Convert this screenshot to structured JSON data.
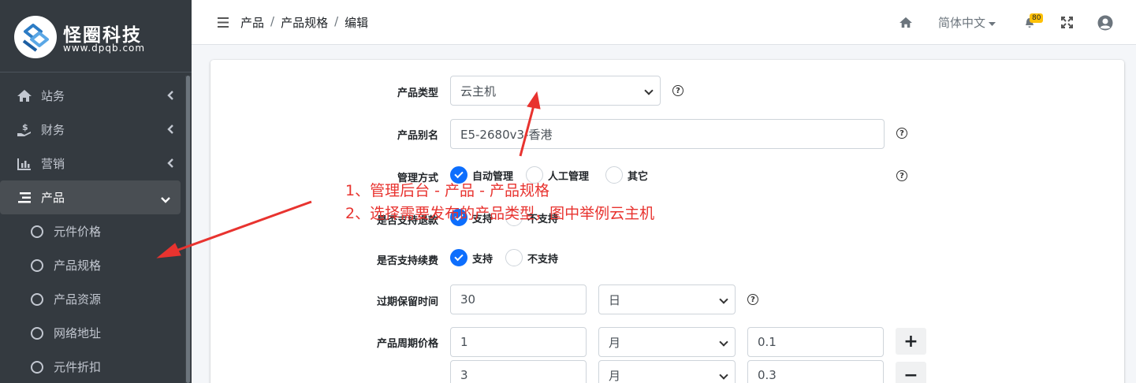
{
  "brand": {
    "name": "怪圈科技",
    "url": "www.dpqb.com"
  },
  "sidebar": {
    "items": [
      {
        "label": "站务",
        "icon": "home-icon"
      },
      {
        "label": "财务",
        "icon": "hand-dollar-icon"
      },
      {
        "label": "营销",
        "icon": "bar-chart-icon"
      },
      {
        "label": "产品",
        "icon": "list-icon"
      }
    ],
    "sub_items": [
      {
        "label": "元件价格"
      },
      {
        "label": "产品规格"
      },
      {
        "label": "产品资源"
      },
      {
        "label": "网络地址"
      },
      {
        "label": "元件折扣"
      }
    ]
  },
  "header": {
    "breadcrumb": [
      "产品",
      "产品规格",
      "编辑"
    ],
    "language": "简体中文",
    "notification_count": "80"
  },
  "form": {
    "product_type": {
      "label": "产品类型",
      "value": "云主机",
      "help": "?"
    },
    "product_alias": {
      "label": "产品别名",
      "value": "E5-2680v3-香港",
      "help": "?"
    },
    "management": {
      "label": "管理方式",
      "options": [
        "自动管理",
        "人工管理",
        "其它"
      ],
      "selected": "自动管理",
      "help": "?"
    },
    "refund": {
      "label": "是否支持退款",
      "options": [
        "支持",
        "不支持"
      ],
      "selected": "支持"
    },
    "renew": {
      "label": "是否支持续费",
      "options": [
        "支持",
        "不支持"
      ],
      "selected": "支持"
    },
    "retention": {
      "label": "过期保留时间",
      "value": "30",
      "unit": "日",
      "help": "?"
    },
    "period_price": {
      "label": "产品周期价格",
      "rows": [
        {
          "count": "1",
          "unit": "月",
          "price": "0.1",
          "action": "+"
        },
        {
          "count": "3",
          "unit": "月",
          "price": "0.3",
          "action": "−"
        }
      ]
    }
  },
  "annotations": {
    "line1": "1、管理后台 - 产品 - 产品规格",
    "line2": "2、选择需要发布的产品类型，图中举例云主机",
    "color": "#e8332f"
  }
}
